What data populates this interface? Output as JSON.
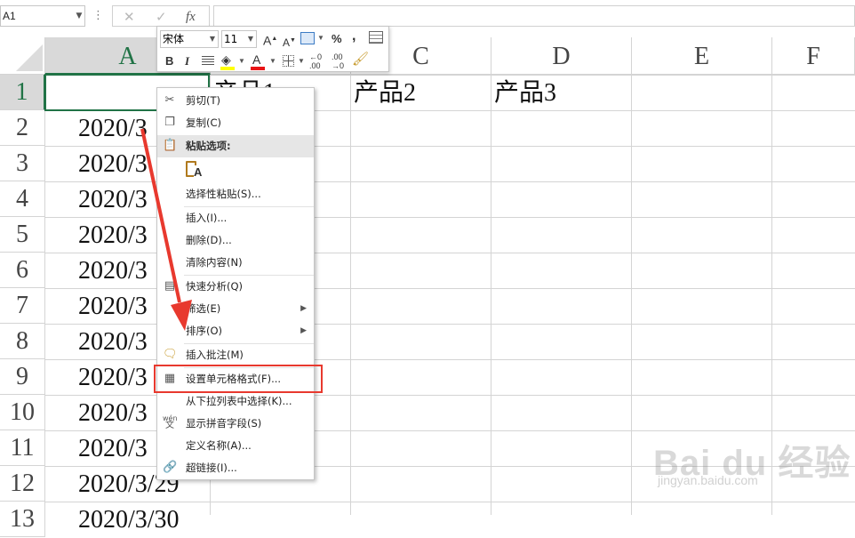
{
  "formula_bar": {
    "name_box": "A1",
    "fx": "fx",
    "cancel": "✕",
    "enter": "✓"
  },
  "columns": [
    "A",
    "C",
    "D",
    "E",
    "F"
  ],
  "rows": [
    "1",
    "2",
    "3",
    "4",
    "5",
    "6",
    "7",
    "8",
    "9",
    "10",
    "11",
    "12",
    "13"
  ],
  "cells": {
    "b1": "产品1",
    "c1": "产品2",
    "d1": "产品3",
    "a_visible": [
      "2020/3",
      "2020/3",
      "2020/3",
      "2020/3",
      "2020/3",
      "2020/3",
      "2020/3",
      "2020/3",
      "2020/3",
      "2020/3",
      "2020/3/29",
      "2020/3/30"
    ]
  },
  "mini_toolbar": {
    "font_name": "宋体",
    "font_size": "11",
    "bold": "B",
    "italic": "I",
    "percent": "%",
    "comma": ",",
    "grow_font": "A",
    "shrink_font": "A",
    "font_color": "A"
  },
  "context_menu": {
    "items": [
      {
        "label": "剪切(T)",
        "icon": "scissors-icon"
      },
      {
        "label": "复制(C)",
        "icon": "copy-icon"
      },
      {
        "label": "粘贴选项:",
        "icon": "paste-icon"
      },
      {
        "label": "选择性粘贴(S)..."
      },
      {
        "label": "插入(I)..."
      },
      {
        "label": "删除(D)..."
      },
      {
        "label": "清除内容(N)"
      },
      {
        "label": "快速分析(Q)",
        "icon": "quick-analysis-icon"
      },
      {
        "label": "筛选(E)"
      },
      {
        "label": "排序(O)"
      },
      {
        "label": "插入批注(M)",
        "icon": "comment-icon"
      },
      {
        "label": "设置单元格格式(F)...",
        "icon": "format-cells-icon"
      },
      {
        "label": "从下拉列表中选择(K)..."
      },
      {
        "label": "显示拼音字段(S)",
        "icon": "pinyin-icon"
      },
      {
        "label": "定义名称(A)..."
      },
      {
        "label": "超链接(I)...",
        "icon": "hyperlink-icon"
      }
    ],
    "paste_icon_glyph": "A",
    "pinyin_icon_top": "wén",
    "pinyin_icon_bottom": "文"
  },
  "colors": {
    "accent": "#217346",
    "arrow": "#e8392e",
    "highlight": "#e8392e"
  },
  "watermark": {
    "logo": "Bai du 经验",
    "url": "jingyan.baidu.com"
  }
}
